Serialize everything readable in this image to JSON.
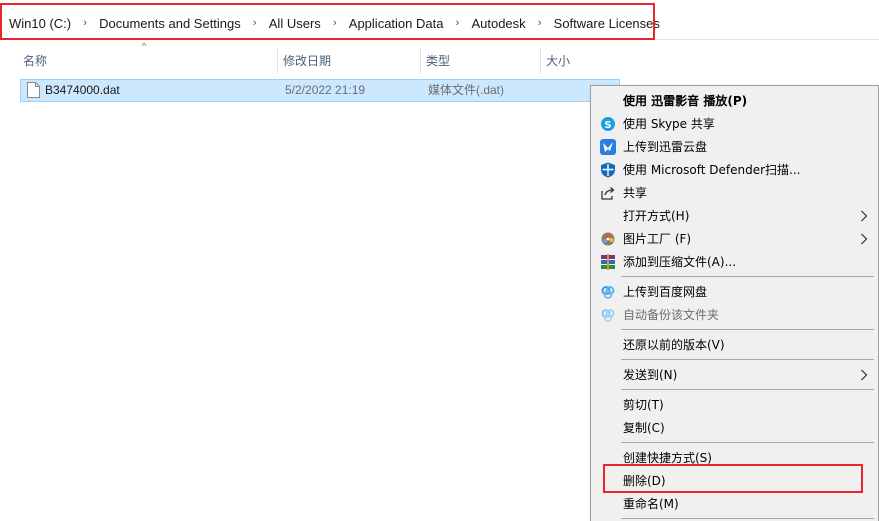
{
  "breadcrumb": {
    "items": [
      "Win10 (C:)",
      "Documents and Settings",
      "All Users",
      "Application Data",
      "Autodesk",
      "Software Licenses"
    ],
    "separator": "›"
  },
  "columns": {
    "name": "名称",
    "modified": "修改日期",
    "type": "类型",
    "size": "大小",
    "sort_indicator": "^"
  },
  "file": {
    "name": "B3474000.dat",
    "modified": "5/2/2022 21:19",
    "type": "媒体文件(.dat)"
  },
  "context_menu": {
    "play_with": "使用 迅雷影音 播放(P)",
    "skype_share": "使用 Skype 共享",
    "thunder_cloud": "上传到迅雷云盘",
    "defender_scan": "使用 Microsoft Defender扫描...",
    "share": "共享",
    "open_with": "打开方式(H)",
    "picture_factory": "图片工厂 (F)",
    "add_to_archive": "添加到压缩文件(A)...",
    "baidu_upload": "上传到百度网盘",
    "baidu_backup": "自动备份该文件夹",
    "restore_previous": "还原以前的版本(V)",
    "send_to": "发送到(N)",
    "cut": "剪切(T)",
    "copy": "复制(C)",
    "create_shortcut": "创建快捷方式(S)",
    "delete": "删除(D)",
    "rename": "重命名(M)"
  },
  "colors": {
    "highlight_red": "#e8262c",
    "selection_bg": "#cce8ff",
    "menu_bg": "#f0f0f0",
    "header_text": "#4c607a"
  }
}
